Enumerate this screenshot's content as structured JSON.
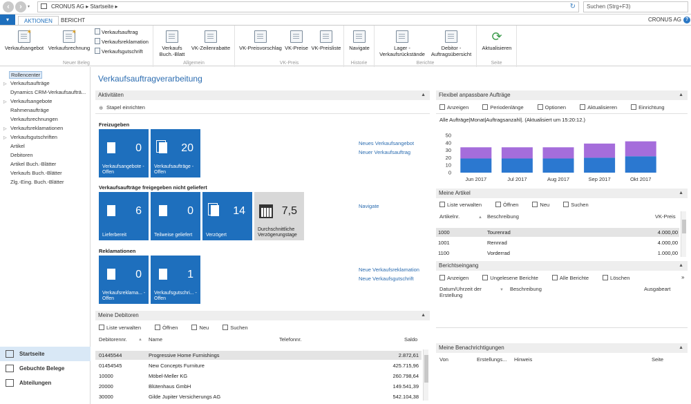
{
  "address": {
    "company": "CRONUS AG",
    "page": "Startseite",
    "search_placeholder": "Suchen (Strg+F3)"
  },
  "ribbon": {
    "tabs": [
      "AKTIONEN",
      "BERICHT"
    ],
    "company": "CRONUS AG",
    "groups": {
      "neuer_beleg": {
        "label": "Neuer Beleg",
        "big": [
          "Verkaufsangebot",
          "Verkaufsrechnung"
        ],
        "small": [
          "Verkaufsauftrag",
          "Verkaufsreklamation",
          "Verkaufsgutschrift"
        ]
      },
      "allgemein": {
        "label": "Allgemein",
        "buttons": [
          "Verkaufs Buch.-Blatt",
          "VK-Zeilenrabatte"
        ]
      },
      "vk_preis": {
        "label": "VK-Preis",
        "buttons": [
          "VK-Preisvorschlag",
          "VK-Preise",
          "VK-Preisliste"
        ]
      },
      "historie": {
        "label": "Historie",
        "buttons": [
          "Navigate"
        ]
      },
      "berichte": {
        "label": "Berichte",
        "buttons": [
          "Lager - Verkaufsrückstände",
          "Debitor - Auftragsübersicht"
        ]
      },
      "seite": {
        "label": "Seite",
        "buttons": [
          "Aktualisieren"
        ]
      }
    }
  },
  "sidebar": {
    "items": [
      {
        "label": "Rollencenter",
        "arrow": false
      },
      {
        "label": "Verkaufsaufträge",
        "arrow": true
      },
      {
        "label": "Dynamics CRM-Verkaufsaufträ...",
        "arrow": false
      },
      {
        "label": "Verkaufsangebote",
        "arrow": true
      },
      {
        "label": "Rahmenaufträge",
        "arrow": false
      },
      {
        "label": "Verkaufsrechnungen",
        "arrow": false
      },
      {
        "label": "Verkaufsreklamationen",
        "arrow": true
      },
      {
        "label": "Verkaufsgutschriften",
        "arrow": true
      },
      {
        "label": "Artikel",
        "arrow": false
      },
      {
        "label": "Debitoren",
        "arrow": false
      },
      {
        "label": "Artikel Buch.-Blätter",
        "arrow": false
      },
      {
        "label": "Verkaufs Buch.-Blätter",
        "arrow": false
      },
      {
        "label": "Zlg.-Eing. Buch.-Blätter",
        "arrow": false
      }
    ],
    "footer": [
      "Startseite",
      "Gebuchte Belege",
      "Abteilungen"
    ]
  },
  "page_title": "Verkaufsauftragverarbeitung",
  "activities": {
    "title": "Aktivitäten",
    "action": "Stapel einrichten",
    "sections": [
      {
        "title": "Freizugeben",
        "tiles": [
          {
            "value": "0",
            "label": "Verkaufsangebote - Offen"
          },
          {
            "value": "20",
            "label": "Verkaufsaufträge - Offen"
          }
        ],
        "links": [
          "Neues Verkaufsangebot",
          "Neuer Verkaufsauftrag"
        ]
      },
      {
        "title": "Verkaufsaufträge freigegeben nicht geliefert",
        "tiles": [
          {
            "value": "6",
            "label": "Lieferbereit"
          },
          {
            "value": "0",
            "label": "Teilweise geliefert"
          },
          {
            "value": "14",
            "label": "Verzögert"
          },
          {
            "value": "7,5",
            "label": "Durchschnittliche Verzögerungstage"
          }
        ],
        "links": [
          "Navigate"
        ]
      },
      {
        "title": "Reklamationen",
        "tiles": [
          {
            "value": "0",
            "label": "Verkaufsreklama... - Offen"
          },
          {
            "value": "1",
            "label": "Verkaufsgutschri... - Offen"
          }
        ],
        "links": [
          "Neue Verkaufsreklamation",
          "Neue Verkaufsgutschrift"
        ]
      }
    ]
  },
  "debitoren": {
    "title": "Meine Debitoren",
    "actions": [
      "Liste verwalten",
      "Öffnen",
      "Neu",
      "Suchen"
    ],
    "columns": [
      "Debitorennr.",
      "Name",
      "Telefonnr.",
      "Saldo"
    ],
    "rows": [
      [
        "01445544",
        "Progressive Home Furnishings",
        "",
        "2.872,61"
      ],
      [
        "01454545",
        "New Concepts Furniture",
        "",
        "425.715,96"
      ],
      [
        "10000",
        "Möbel-Meller KG",
        "",
        "260.798,64"
      ],
      [
        "20000",
        "Blütenhaus GmbH",
        "",
        "149.541,39"
      ],
      [
        "30000",
        "Gilde Jupiter Versicherungs AG",
        "",
        "542.104,38"
      ]
    ]
  },
  "flexibel": {
    "title": "Flexibel anpassbare Aufträge",
    "actions": [
      "Anzeigen",
      "Periodenlänge",
      "Optionen",
      "Aktualisieren",
      "Einrichtung"
    ],
    "status": "Alle Aufträge|Monat|Auftragsanzahl|. (Aktualisiert um 15:20:12.)"
  },
  "chart_data": {
    "type": "bar",
    "categories": [
      "Jun 2017",
      "Jul 2017",
      "Aug 2017",
      "Sep 2017",
      "Okt 2017"
    ],
    "series": [
      {
        "name": "",
        "color": "#2b78d0",
        "values": [
          19,
          19,
          19,
          20,
          22
        ]
      },
      {
        "name": "",
        "color": "#a56ddb",
        "values": [
          15,
          15,
          15,
          19,
          20
        ]
      }
    ],
    "ylim": [
      0,
      50
    ],
    "yticks": [
      0,
      10,
      20,
      30,
      40,
      50
    ],
    "grid": false
  },
  "artikel": {
    "title": "Meine Artikel",
    "actions": [
      "Liste verwalten",
      "Öffnen",
      "Neu",
      "Suchen"
    ],
    "columns": [
      "Artikelnr.",
      "Beschreibung",
      "VK-Preis"
    ],
    "rows": [
      [
        "1000",
        "Tourenrad",
        "4.000,00"
      ],
      [
        "1001",
        "Rennrad",
        "4.000,00"
      ],
      [
        "1100",
        "Vorderrad",
        "1.000,00"
      ]
    ]
  },
  "berichtseingang": {
    "title": "Berichtseingang",
    "actions": [
      "Anzeigen",
      "Ungelesene Berichte",
      "Alle Berichte",
      "Löschen"
    ],
    "columns": [
      "Datum/Uhrzeit der Erstellung",
      "Beschreibung",
      "Ausgabeart"
    ]
  },
  "benachrichtigungen": {
    "title": "Meine Benachrichtigungen",
    "columns": [
      "Von",
      "Erstellungs...",
      "Hinweis",
      "Seite"
    ]
  }
}
